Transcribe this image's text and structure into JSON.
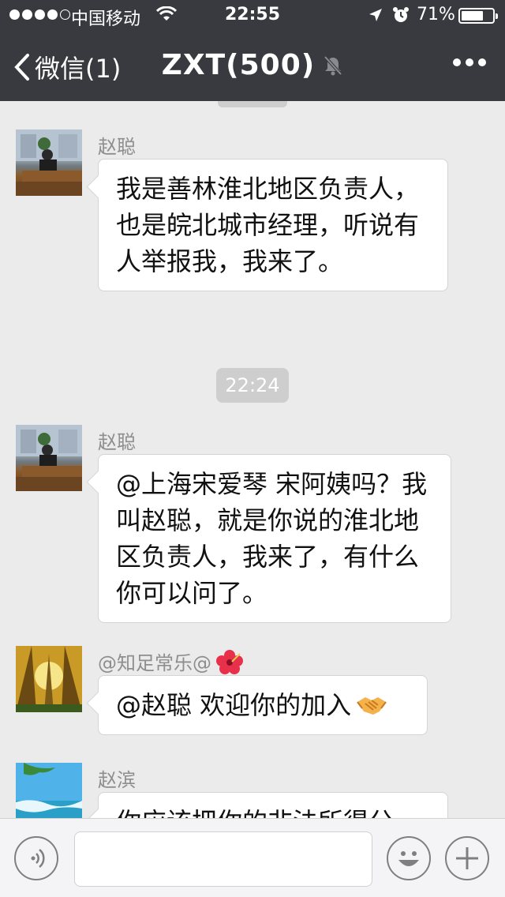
{
  "status_bar": {
    "carrier": "中国移动",
    "time": "22:55",
    "battery": "71%",
    "battery_level": 0.71,
    "signal_bars_filled": 4,
    "signal_bars_total": 5
  },
  "nav": {
    "back_label": "微信(1)",
    "title": "ZXT(500)"
  },
  "chat": {
    "time_label": "22:24",
    "messages": [
      {
        "sender": "赵聪",
        "text": "我是善林淮北地区负责人，也是皖北城市经理，听说有人举报我，我来了。"
      },
      {
        "sender": "赵聪",
        "text": "@上海宋爱琴 宋阿姨吗？我叫赵聪，就是你说的淮北地区负责人，我来了，有什么你可以问了。"
      },
      {
        "sender": "@知足常乐@",
        "sender_emoji": "hibiscus",
        "text": "@赵聪 欢迎你的加入",
        "text_emoji": "handshake"
      },
      {
        "sender": "赵滨",
        "text": "你应该把你的非法所得分"
      }
    ]
  },
  "colors": {
    "top_bar": "#393a3f",
    "chat_bg": "#ebebeb",
    "bubble": "#ffffff"
  }
}
